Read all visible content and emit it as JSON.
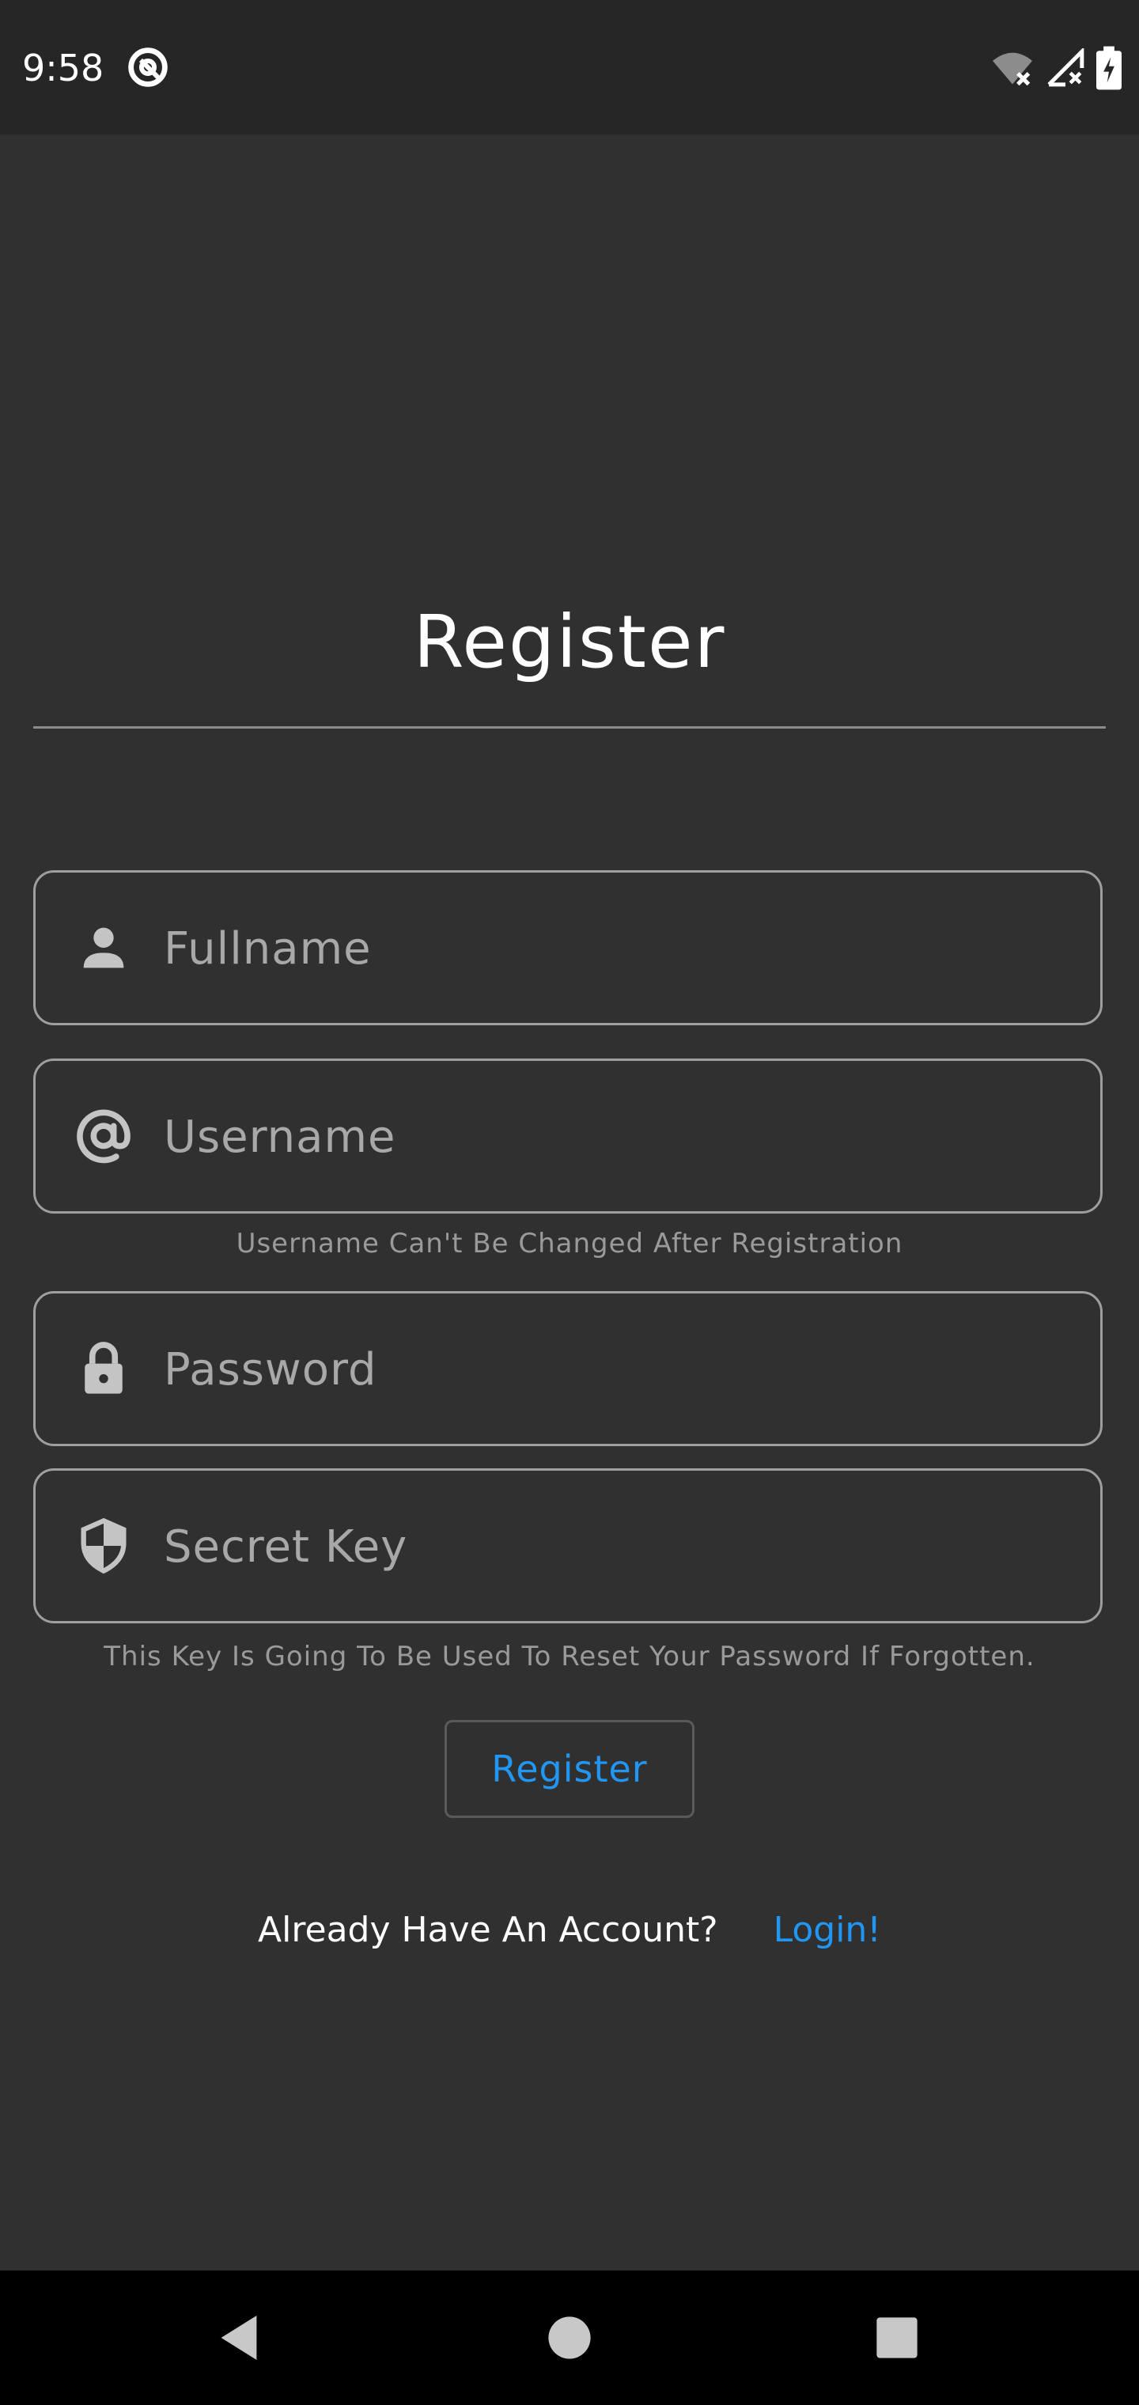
{
  "status_bar": {
    "time": "9:58",
    "icons": [
      "app-notification-icon",
      "wifi-off-icon",
      "signal-off-icon",
      "battery-charging-icon"
    ]
  },
  "register_form": {
    "title": "Register",
    "fields": {
      "fullname": {
        "placeholder": "Fullname",
        "value": "",
        "icon": "person-icon"
      },
      "username": {
        "placeholder": "Username",
        "value": "",
        "icon": "at-icon"
      },
      "password": {
        "placeholder": "Password",
        "value": "",
        "icon": "lock-icon"
      },
      "secret_key": {
        "placeholder": "Secret Key",
        "value": "",
        "icon": "shield-icon"
      }
    },
    "username_helper": "Username Can't Be Changed After Registration",
    "secret_key_helper": "This Key Is Going To Be Used To Reset Your Password If Forgotten.",
    "submit_label": "Register",
    "login_prompt": "Already Have An Account?",
    "login_link": "Login!"
  },
  "navigation_bar": {
    "buttons": [
      "back-icon",
      "home-icon",
      "recents-icon"
    ]
  },
  "colors": {
    "background": "#303031",
    "status_bar": "#262627",
    "accent": "#2196f3",
    "border": "#9e9e9e",
    "nav_bar": "#000000"
  }
}
